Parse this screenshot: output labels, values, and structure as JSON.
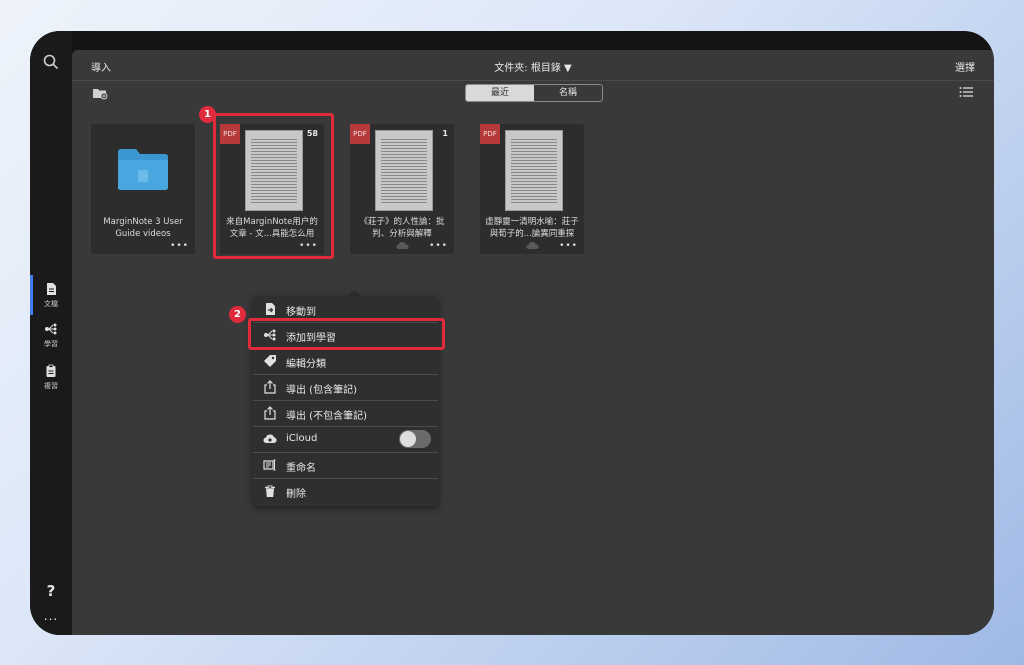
{
  "header": {
    "import": "導入",
    "folder": "文件夾: 根目錄 ▼",
    "select": "選擇"
  },
  "sort": {
    "recent": "最近",
    "name": "名稱"
  },
  "sidebar": {
    "items": [
      {
        "label": "文檔",
        "icon": "document-icon"
      },
      {
        "label": "學習",
        "icon": "mindmap-icon"
      },
      {
        "label": "複習",
        "icon": "review-icon"
      }
    ],
    "help": "?",
    "more": "..."
  },
  "cards": [
    {
      "title": "MarginNote 3 User Guide videos",
      "type": "folder"
    },
    {
      "badge": "PDF",
      "count": "58",
      "title": "来自MarginNote用户的文章 - 文...具能怎么用"
    },
    {
      "badge": "PDF",
      "count": "1",
      "title": "《莊子》的人性論：批判、分析與解釋"
    },
    {
      "badge": "PDF",
      "title": "虛靜靈一清明水喻：莊子與荀子的...論異同重探"
    }
  ],
  "menu": {
    "items": [
      {
        "label": "移動到",
        "icon": "move-icon"
      },
      {
        "label": "添加到學習",
        "icon": "mindmap-icon"
      },
      {
        "label": "編輯分類",
        "icon": "tag-icon"
      },
      {
        "label": "導出 (包含筆記)",
        "icon": "share-icon"
      },
      {
        "label": "導出 (不包含筆記)",
        "icon": "share-icon"
      },
      {
        "label": "iCloud",
        "icon": "cloud-icon",
        "toggle": false
      },
      {
        "label": "重命名",
        "icon": "rename-icon"
      },
      {
        "label": "刪除",
        "icon": "trash-icon"
      }
    ]
  },
  "annotations": {
    "step1": "1",
    "step2": "2"
  },
  "colors": {
    "accent": "#3f7cf0",
    "highlight": "#e02b3c",
    "pdf": "#b73a3a",
    "folder": "#3c96d0"
  }
}
